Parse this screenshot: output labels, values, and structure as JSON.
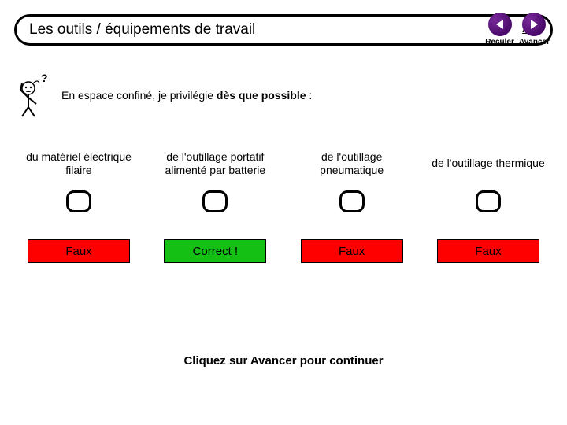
{
  "header": {
    "title": "Les outils / équipements de travail",
    "aide": "Aide",
    "back_label": "Reculer",
    "forward_label": "Avancer"
  },
  "prompt": {
    "prefix": "En espace confiné, je privilégie ",
    "bold": "dès que possible",
    "suffix": " :"
  },
  "options": [
    {
      "label": "du matériel électrique filaire",
      "feedback": "Faux",
      "state": "wrong"
    },
    {
      "label": "de l'outillage portatif alimenté par batterie",
      "feedback": "Correct !",
      "state": "correct"
    },
    {
      "label": "de l'outillage pneumatique",
      "feedback": "Faux",
      "state": "wrong"
    },
    {
      "label": "de l'outillage thermique",
      "feedback": "Faux",
      "state": "wrong"
    }
  ],
  "footer": "Cliquez sur Avancer pour continuer"
}
